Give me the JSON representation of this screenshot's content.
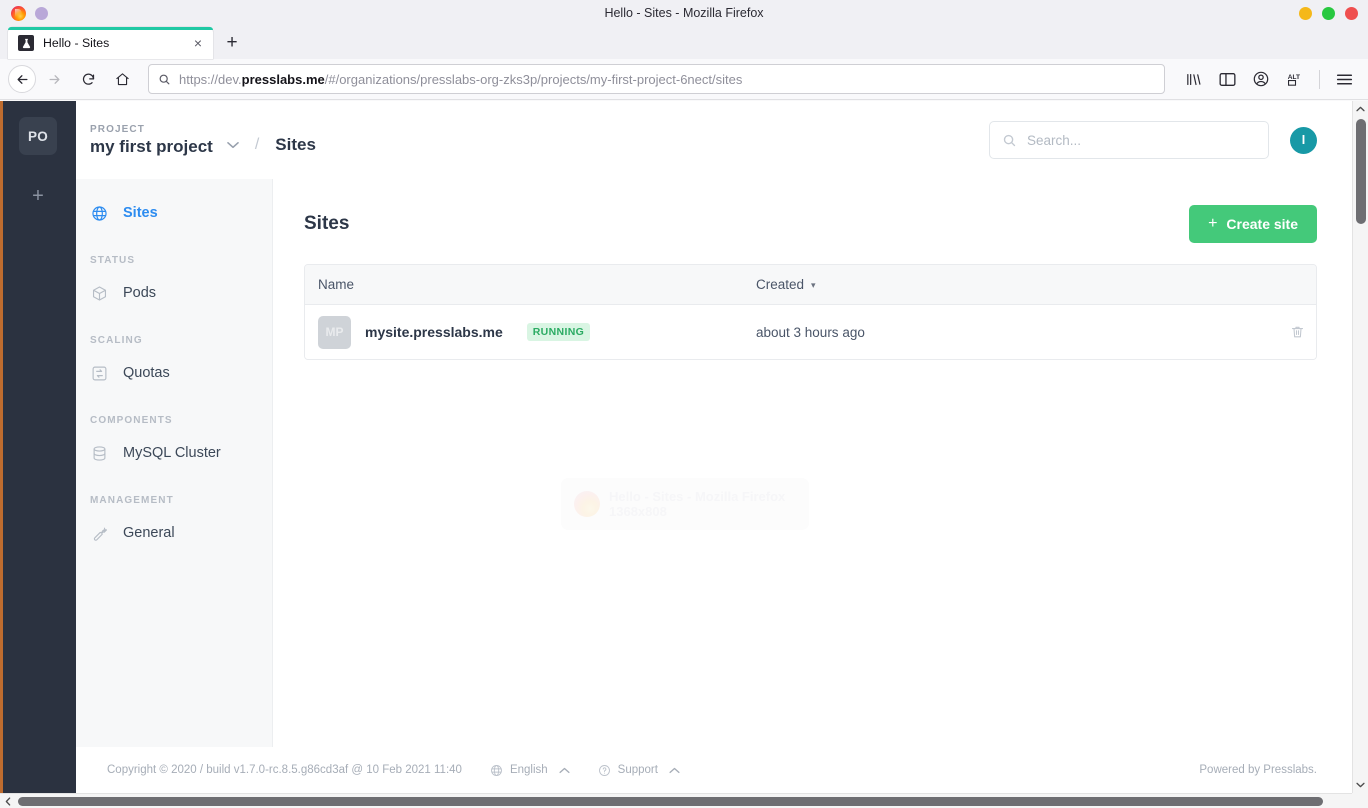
{
  "browser": {
    "window_title": "Hello - Sites - Mozilla Firefox",
    "tab": {
      "title": "Hello - Sites",
      "favicon": "flask-icon",
      "close": "×"
    },
    "newtab_label": "+",
    "nav": {
      "back": "←",
      "forward": "→",
      "reload": "↻",
      "home": "⌂"
    },
    "url": {
      "scheme": "https://dev.",
      "domain": "presslabs.me",
      "path": "/#/organizations/presslabs-org-zks3p/projects/my-first-project-6nect/sites",
      "full": "https://dev.presslabs.me/#/organizations/presslabs-org-zks3p/projects/my-first-project-6nect/sites"
    },
    "toolbar_icons": [
      "library-icon",
      "sidebar-icon",
      "account-icon",
      "alt-extension-icon",
      "hamburger-menu-icon"
    ],
    "window_controls": [
      "minimize-dot",
      "maximize-dot",
      "close-dot"
    ],
    "window_control_colors": [
      "#f5b819",
      "#28c840",
      "#ef4f4f"
    ],
    "titlebar_left_icons": [
      "firefox-logo",
      "purple-dot"
    ]
  },
  "rail": {
    "org_initials": "PO",
    "add_label": "+"
  },
  "header": {
    "project_kicker": "PROJECT",
    "project_name": "my first project",
    "chevron": "⌄",
    "separator": "/",
    "page": "Sites",
    "search_placeholder": "Search...",
    "user_initial": "I",
    "accent_color": "#1899a6"
  },
  "sidebar": {
    "items": [
      {
        "label": "Sites",
        "icon": "globe-icon",
        "active": true
      },
      {
        "label": "Pods",
        "icon": "cube-icon",
        "active": false
      },
      {
        "label": "Quotas",
        "icon": "quota-icon",
        "active": false
      },
      {
        "label": "MySQL Cluster",
        "icon": "database-icon",
        "active": false
      },
      {
        "label": "General",
        "icon": "wrench-icon",
        "active": false
      }
    ],
    "sections": {
      "status": "STATUS",
      "scaling": "SCALING",
      "components": "COMPONENTS",
      "management": "MANAGEMENT"
    },
    "active_color": "#2d8cf0"
  },
  "main": {
    "title": "Sites",
    "create_button": {
      "label": "Create site",
      "plus": "+",
      "color": "#44c97a"
    },
    "table": {
      "columns": {
        "name": "Name",
        "created": "Created",
        "sort_caret": "▾"
      },
      "rows": [
        {
          "avatar": "MP",
          "name": "mysite.presslabs.me",
          "status": "RUNNING",
          "status_color": "#2bab63",
          "created": "about 3 hours ago",
          "delete_icon": "trash-icon"
        }
      ]
    }
  },
  "overlay": {
    "line1": "Hello - Sites - Mozilla Firefox",
    "line2": "1368x808"
  },
  "footer": {
    "copyright": "Copyright © 2020 / build v1.7.0-rc.8.5.g86cd3af @ 10 Feb 2021 11:40",
    "language": "English",
    "support": "Support",
    "powered_by": "Powered by Presslabs.",
    "chevron_up": "⌃"
  }
}
